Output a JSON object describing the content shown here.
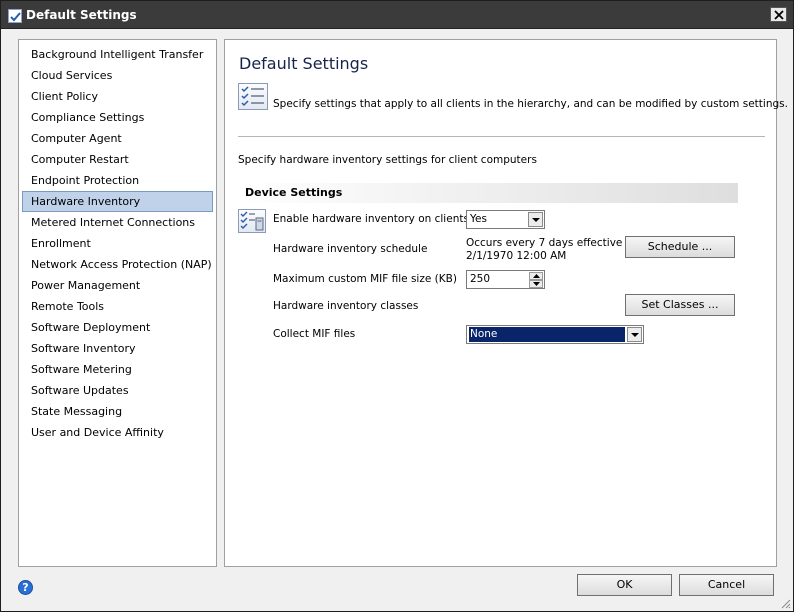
{
  "window": {
    "title": "Default Settings",
    "icon": "checkbox-app-icon",
    "close_icon": "close-icon"
  },
  "sidebar": {
    "selected": "Hardware Inventory",
    "items": [
      {
        "label": "Background Intelligent Transfer"
      },
      {
        "label": "Cloud Services"
      },
      {
        "label": "Client Policy"
      },
      {
        "label": "Compliance Settings"
      },
      {
        "label": "Computer Agent"
      },
      {
        "label": "Computer Restart"
      },
      {
        "label": "Endpoint Protection"
      },
      {
        "label": "Hardware Inventory"
      },
      {
        "label": "Metered Internet Connections"
      },
      {
        "label": "Enrollment"
      },
      {
        "label": "Network Access Protection (NAP)"
      },
      {
        "label": "Power Management"
      },
      {
        "label": "Remote Tools"
      },
      {
        "label": "Software Deployment"
      },
      {
        "label": "Software Inventory"
      },
      {
        "label": "Software Metering"
      },
      {
        "label": "Software Updates"
      },
      {
        "label": "State Messaging"
      },
      {
        "label": "User and Device Affinity"
      }
    ]
  },
  "main": {
    "title": "Default Settings",
    "description": "Specify settings that apply to all clients in the hierarchy, and can be modified by custom settings.",
    "sub_description": "Specify hardware inventory settings for client computers",
    "section_title": "Device Settings",
    "settings": {
      "enable": {
        "label": "Enable hardware inventory on clients",
        "value": "Yes"
      },
      "schedule": {
        "label": "Hardware inventory schedule",
        "value_line1": "Occurs every 7 days effective",
        "value_line2": "2/1/1970 12:00 AM",
        "button": "Schedule ..."
      },
      "mif_size": {
        "label": "Maximum custom MIF file size (KB)",
        "value": "250"
      },
      "classes": {
        "label": "Hardware inventory classes",
        "button": "Set Classes ..."
      },
      "collect_mif": {
        "label": "Collect MIF files",
        "value": "None"
      }
    }
  },
  "footer": {
    "ok_label": "OK",
    "cancel_label": "Cancel",
    "help_icon": "help-icon",
    "help_glyph": "?"
  },
  "colors": {
    "titlebar": "#3b3b3b",
    "selection": "#c0d2ea",
    "title_text": "#17234a",
    "highlight": "#0a246a"
  }
}
